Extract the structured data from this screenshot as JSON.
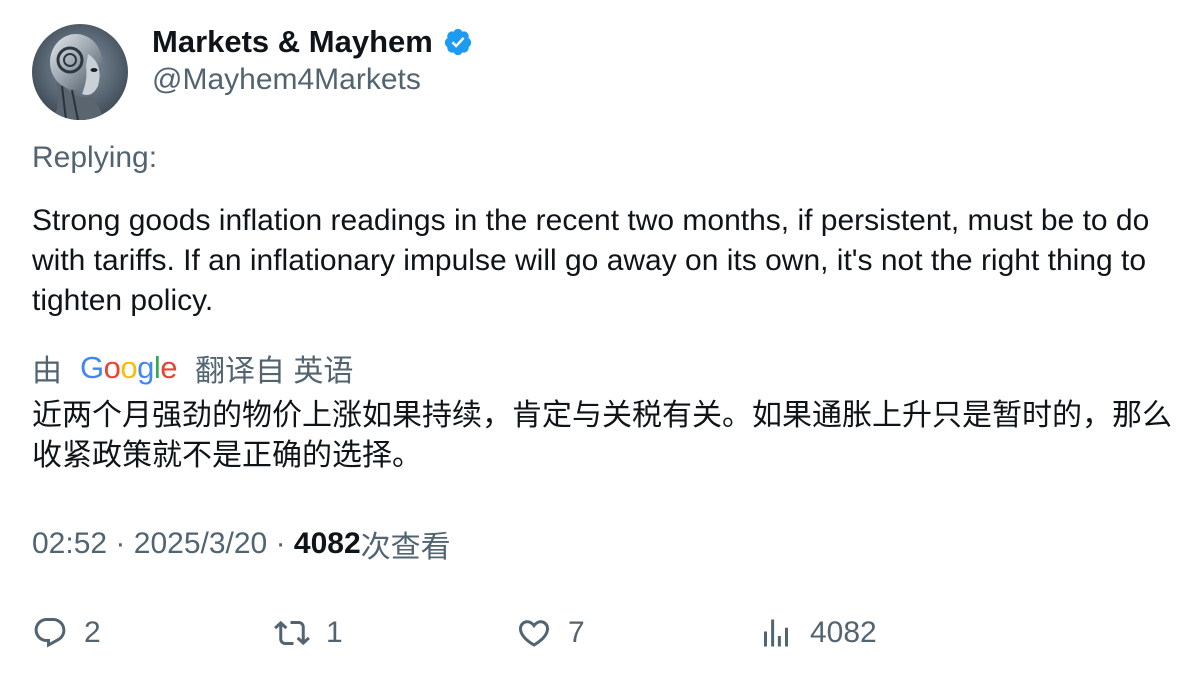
{
  "author": {
    "display_name": "Markets & Mayhem",
    "handle": "@Mayhem4Markets",
    "verified": true,
    "verified_color": "#1d9bf0"
  },
  "replying_label": "Replying:",
  "tweet_text": "Strong goods inflation readings in the recent two months, if persistent, must be to do with tariffs. If an inflationary impulse will go away on its own, it's not the right thing to tighten policy.",
  "translation": {
    "prefix": "由",
    "provider": "Google",
    "label": "翻译自 英语",
    "text": "近两个月强劲的物价上涨如果持续，肯定与关税有关。如果通胀上升只是暂时的，那么收紧政策就不是正确的选择。"
  },
  "meta": {
    "time": "02:52",
    "separator": "·",
    "date": "2025/3/20",
    "views_count": "4082",
    "views_label": "次查看"
  },
  "actions": {
    "replies": "2",
    "retweets": "1",
    "likes": "7",
    "views": "4082"
  },
  "colors": {
    "text_primary": "#0f1419",
    "text_secondary": "#536471",
    "accent": "#1d9bf0"
  }
}
